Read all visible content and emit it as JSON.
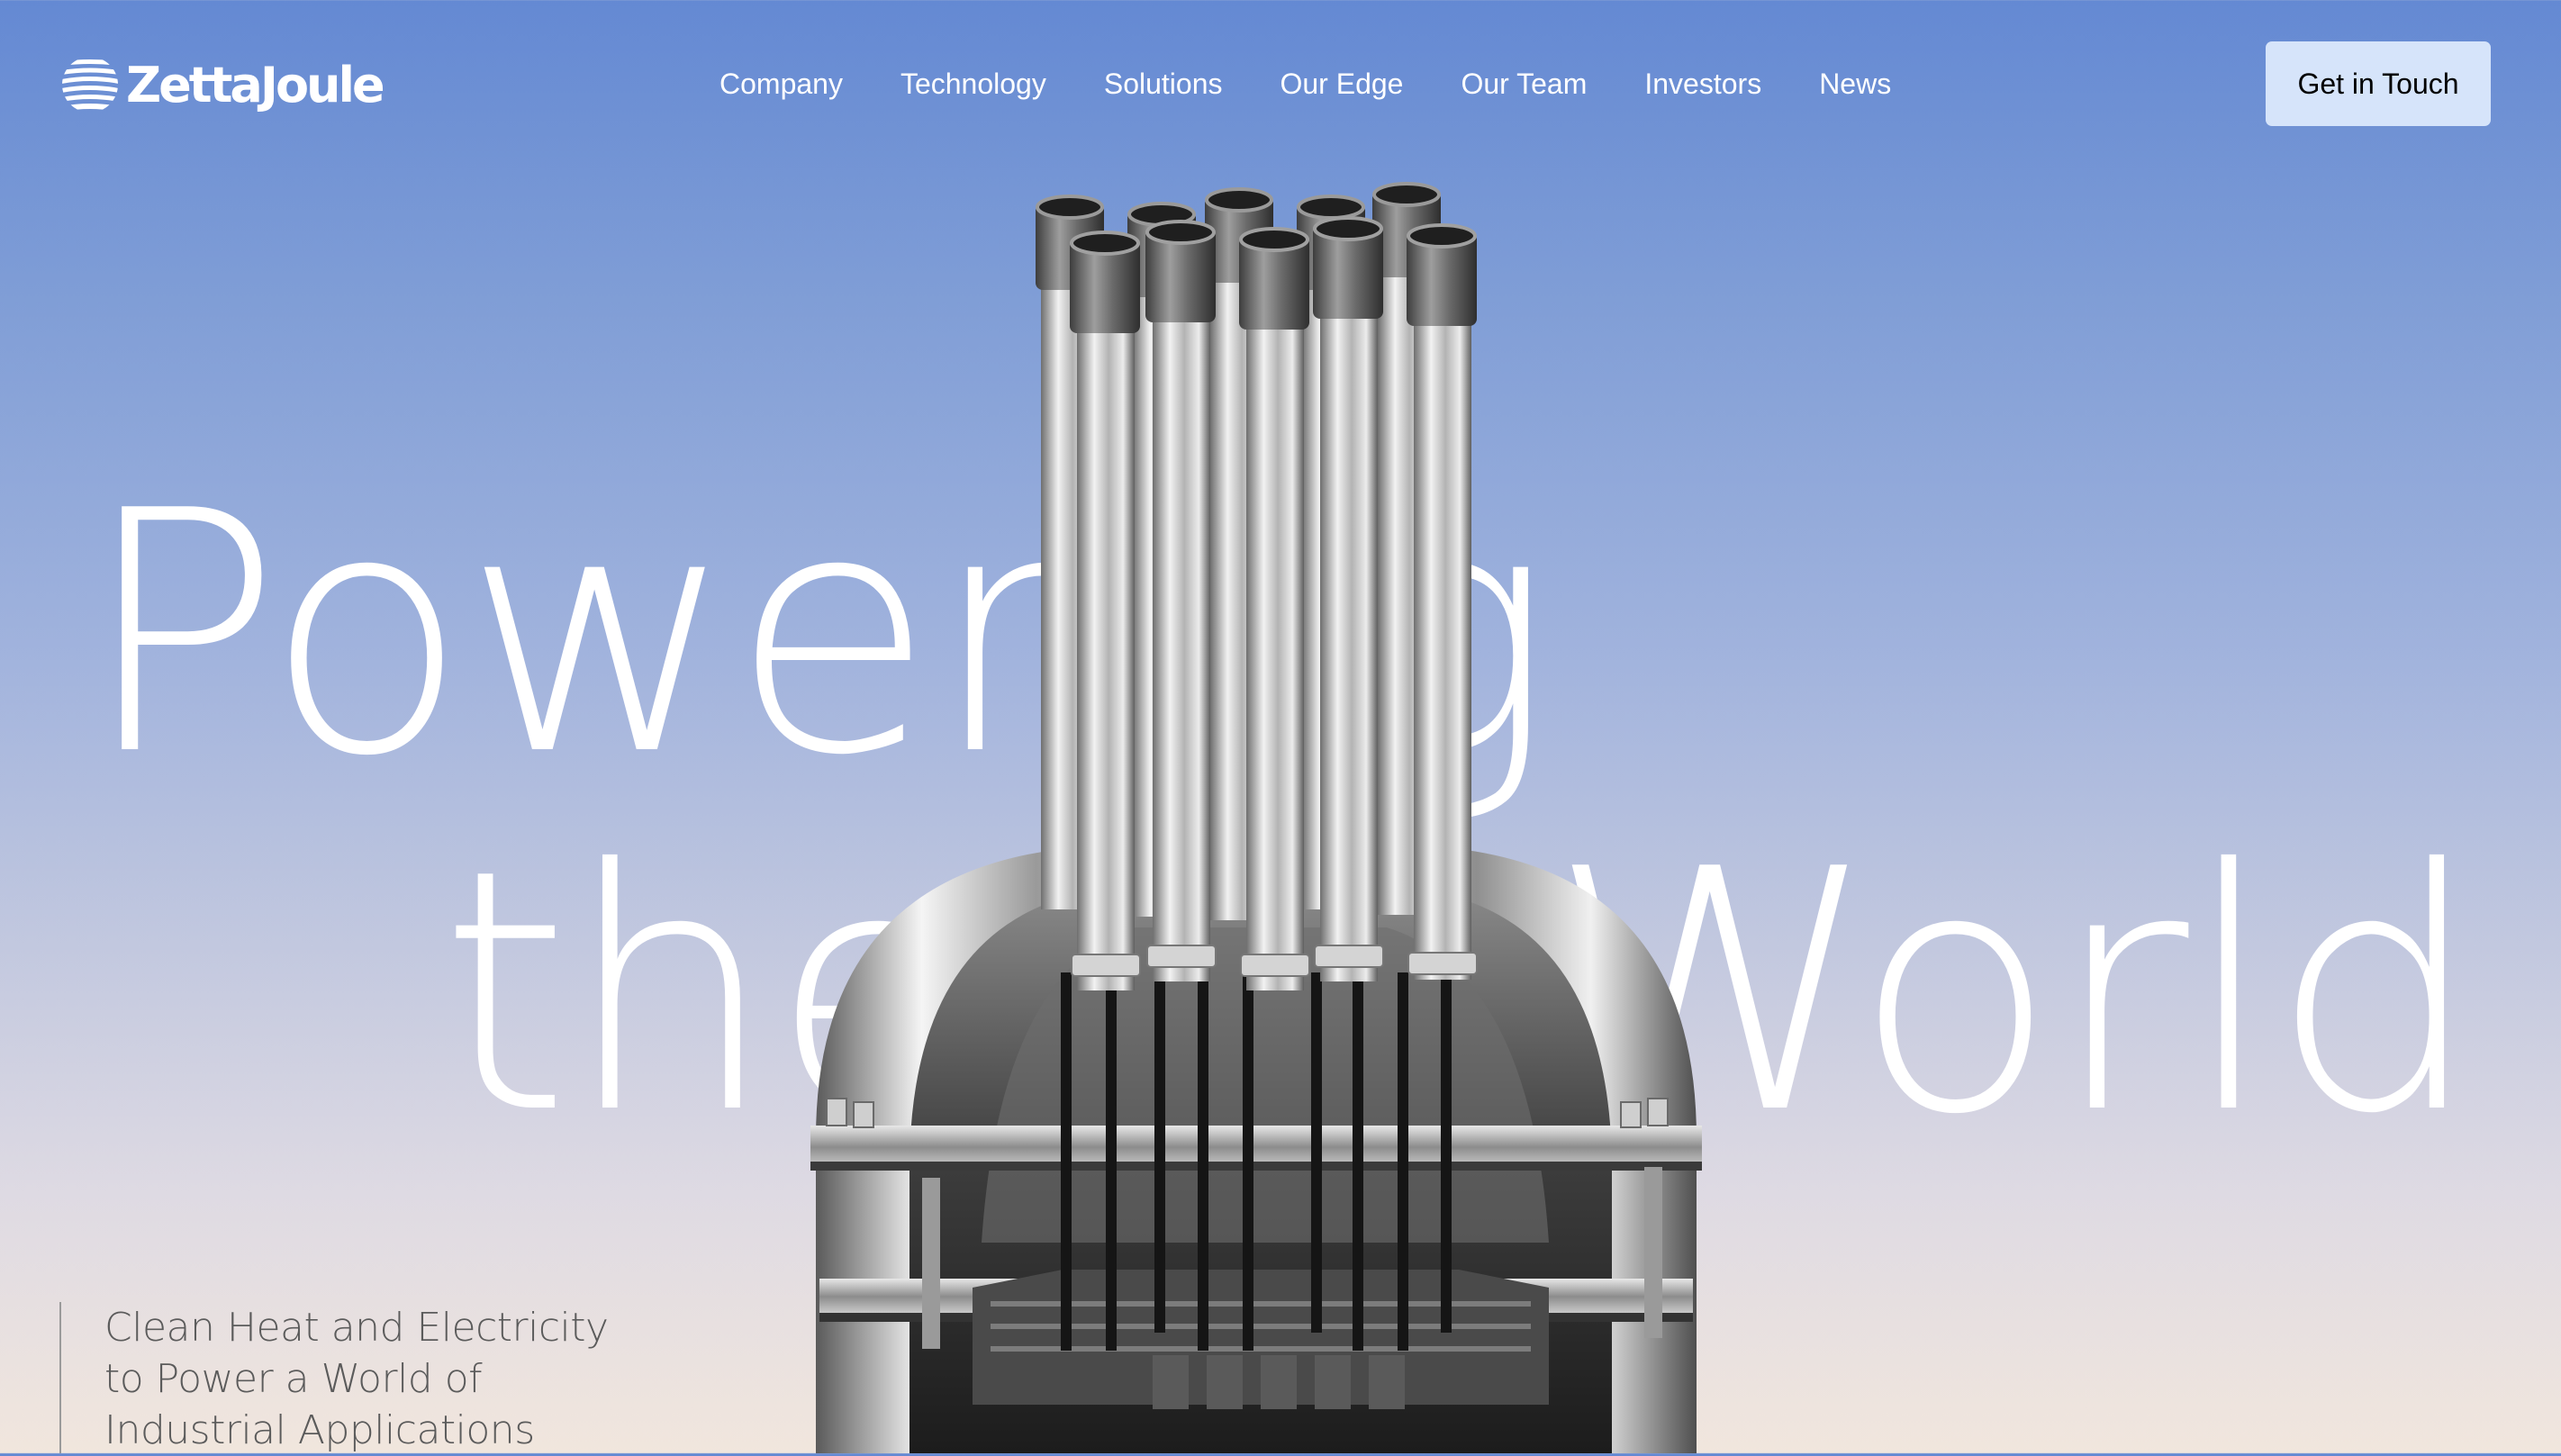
{
  "brand": {
    "name": "ZettaJoule",
    "logo_icon": "zettajoule-globe-icon"
  },
  "nav": {
    "items": [
      {
        "label": "Company"
      },
      {
        "label": "Technology"
      },
      {
        "label": "Solutions"
      },
      {
        "label": "Our Edge"
      },
      {
        "label": "Our Team"
      },
      {
        "label": "Investors"
      },
      {
        "label": "News"
      }
    ],
    "cta_label": "Get in Touch"
  },
  "hero": {
    "headline_line1": "Powering",
    "headline_word2": "the",
    "headline_word3": "World",
    "subheadline_lines": [
      "Clean Heat and Electricity",
      "to Power a World of",
      "Industrial Applications"
    ],
    "image": "reactor-vessel-cutaway"
  },
  "colors": {
    "sky_top": "#6489d3",
    "sky_bottom": "#f1e6dd",
    "cta_bg": "#d6e4fa",
    "text_light": "#ffffff",
    "text_dark": "#5b5b5b"
  }
}
